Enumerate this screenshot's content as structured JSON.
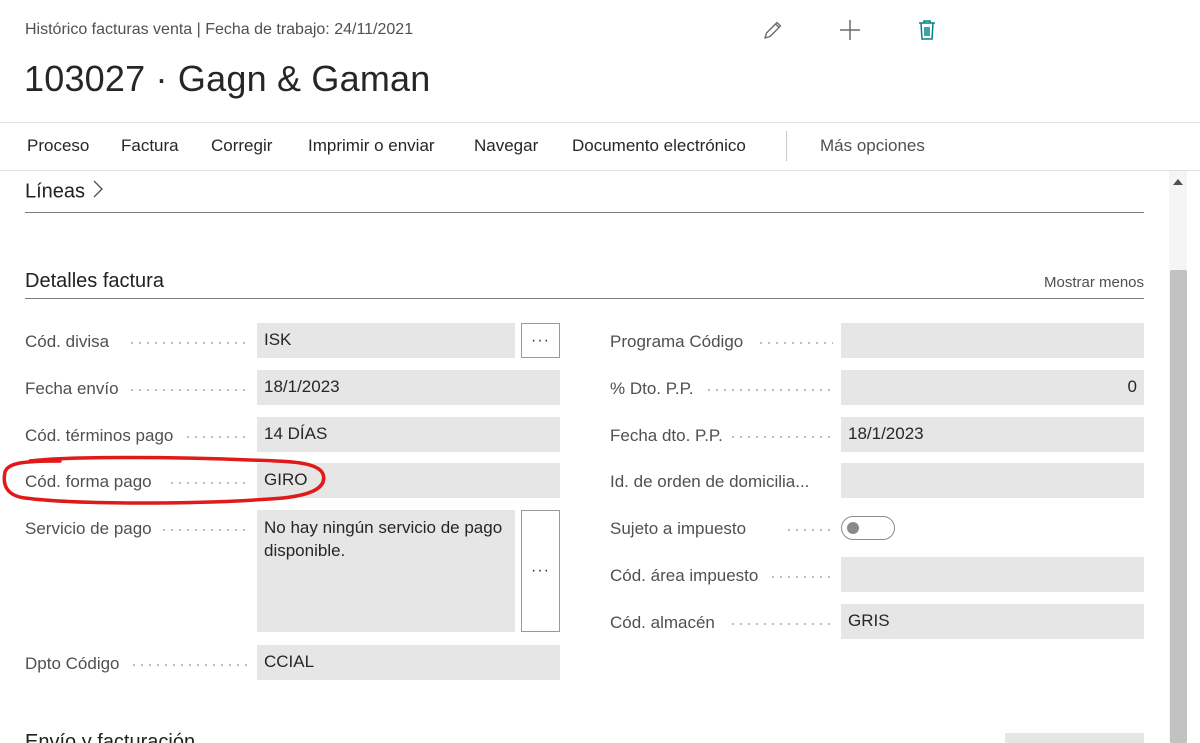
{
  "header": {
    "breadcrumb": "Histórico facturas venta | Fecha de trabajo: 24/11/2021",
    "title": "103027 · Gagn & Gaman",
    "icons": [
      "pencil-icon",
      "plus-icon",
      "trash-icon"
    ]
  },
  "actions": {
    "items": [
      "Proceso",
      "Factura",
      "Corregir",
      "Imprimir o enviar",
      "Navegar",
      "Documento electrónico"
    ],
    "more": "Más opciones"
  },
  "lines_section": {
    "title": "Líneas"
  },
  "details": {
    "title": "Detalles factura",
    "show_less": "Mostrar menos",
    "left": [
      {
        "label": "Cód. divisa",
        "value": "ISK"
      },
      {
        "label": "Fecha envío",
        "value": "18/1/2023"
      },
      {
        "label": "Cód. términos pago",
        "value": "14 DÍAS"
      },
      {
        "label": "Cód. forma pago",
        "value": "GIRO"
      },
      {
        "label": "Servicio de pago",
        "value": "No hay ningún servicio de pago disponible."
      },
      {
        "label": "Dpto Código",
        "value": "CCIAL"
      }
    ],
    "right": [
      {
        "label": "Programa Código",
        "value": ""
      },
      {
        "label": "% Dto. P.P.",
        "value": "0"
      },
      {
        "label": "Fecha dto. P.P.",
        "value": "18/1/2023"
      },
      {
        "label": "Id. de orden de domicilia...",
        "value": ""
      },
      {
        "label": "Sujeto a impuesto",
        "value": ""
      },
      {
        "label": "Cód. área impuesto",
        "value": ""
      },
      {
        "label": "Cód. almacén",
        "value": "GRIS"
      }
    ],
    "tax_liable": false,
    "assist_label": "···"
  },
  "next_section": {
    "title": "Envío y facturación"
  },
  "colors": {
    "accent": "#008489",
    "annotation": "#e01919",
    "field_bg": "#e6e6e6"
  }
}
